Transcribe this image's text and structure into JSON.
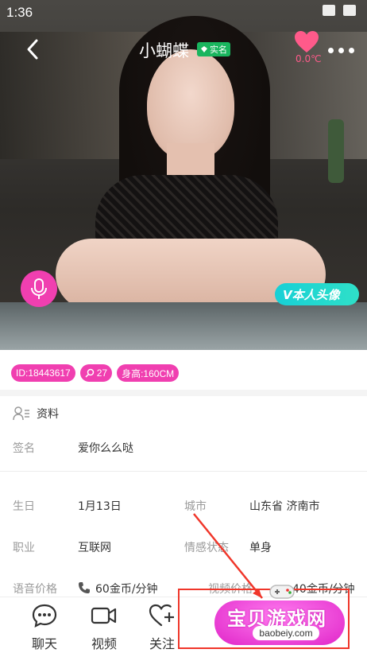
{
  "status_bar": {
    "time": "1:36"
  },
  "header": {
    "title": "小蝴蝶",
    "verified_label": "实名",
    "heart_value": "0.0℃"
  },
  "photo": {
    "badge_label": "V本人头像"
  },
  "tags": [
    {
      "label": "ID:18443617"
    },
    {
      "label": "27"
    },
    {
      "label": "身高:160CM"
    }
  ],
  "profile": {
    "section_title": "资料",
    "signature_label": "签名",
    "signature_value": "爱你么么哒",
    "birthday_label": "生日",
    "birthday_value": "1月13日",
    "city_label": "城市",
    "city_value": "山东省 济南市",
    "job_label": "职业",
    "job_value": "互联网",
    "relationship_label": "情感状态",
    "relationship_value": "单身",
    "voice_price_label": "语音价格",
    "voice_price_value": "60金币/分钟",
    "video_price_label": "视频价格",
    "video_price_value": "40金币/分钟"
  },
  "bottom_nav": [
    {
      "label": "聊天",
      "icon": "chat-icon"
    },
    {
      "label": "视频",
      "icon": "video-camera-icon"
    },
    {
      "label": "关注",
      "icon": "heart-plus-icon"
    }
  ],
  "watermark": {
    "title": "宝贝游戏网",
    "url": "baobeiy.com"
  },
  "colors": {
    "accent": "#f03fb0",
    "verified": "#19b55e",
    "badge": "#17d0d6",
    "watermark_box": "#f0362a"
  }
}
